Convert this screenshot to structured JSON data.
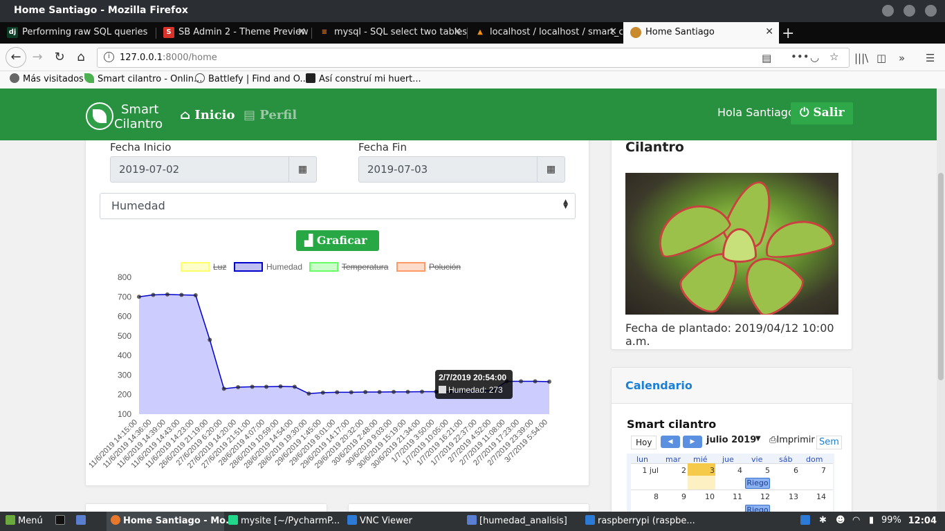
{
  "window": {
    "title": "Home Santiago - Mozilla Firefox"
  },
  "tabs": [
    {
      "label": "Performing raw SQL queries",
      "icon": "dj"
    },
    {
      "label": "SB Admin 2 - Theme Preview",
      "icon": "S"
    },
    {
      "label": "mysql - SQL select two tables",
      "icon": "stackoverflow-icon"
    },
    {
      "label": "localhost / localhost / smart_c",
      "icon": "phpmyadmin-icon"
    },
    {
      "label": "Home Santiago",
      "icon": "site-icon"
    }
  ],
  "address": {
    "host": "127.0.0.1",
    "path": ":8000/home"
  },
  "bookmarks": [
    {
      "label": "Más visitados",
      "icon": "gear-icon"
    },
    {
      "label": "Smart cilantro - Onlin...",
      "icon": "leaf-icon"
    },
    {
      "label": "Battlefy | Find and O...",
      "icon": "globe-icon"
    },
    {
      "label": "Así construí mi huert...",
      "icon": "sbo-icon"
    }
  ],
  "site": {
    "logo_line1": "Smart",
    "logo_line2": "Cilantro",
    "nav_inicio": "Inicio",
    "nav_perfil": "Perfil",
    "greeting": "Hola Santiago",
    "logout": "Salir"
  },
  "filters": {
    "start_label": "Fecha Inicio",
    "start_value": "2019-07-02",
    "end_label": "Fecha Fin",
    "end_value": "2019-07-03",
    "sensor": "Humedad",
    "plot_button": "Graficar"
  },
  "chart_data": {
    "type": "line",
    "legend": [
      "Luz",
      "Humedad",
      "Temperatura",
      "Polución"
    ],
    "legend_colors": [
      "#ffff66",
      "#0000cc",
      "#66ff66",
      "#ff9966"
    ],
    "legend_hidden": [
      true,
      false,
      true,
      true
    ],
    "ylim": [
      100,
      800
    ],
    "yticks": [
      100,
      200,
      300,
      400,
      500,
      600,
      700,
      800
    ],
    "categories": [
      "11/6/2019 14:15:00",
      "11/6/2019 14:36:00",
      "11/6/2019 14:39:00",
      "11/6/2019 14:43:00",
      "11/6/2019 14:23:00",
      "26/6/2019 21:19:00",
      "27/6/2019 6:20:00",
      "27/6/2019 14:20:00",
      "27/6/2019 21:51:00",
      "28/6/2019 4:07:00",
      "28/6/2019 10:59:00",
      "28/6/2019 14:54:00",
      "28/6/2019 19:30:00",
      "29/6/2019 1:45:00",
      "29/6/2019 8:01:00",
      "29/6/2019 14:17:00",
      "29/6/2019 20:32:00",
      "30/6/2019 2:48:00",
      "30/6/2019 9:03:00",
      "30/6/2019 15:19:00",
      "30/6/2019 21:34:00",
      "1/7/2019 3:50:00",
      "1/7/2019 10:05:00",
      "1/7/2019 16:21:00",
      "1/7/2019 22:37:00",
      "2/7/2019 4:52:00",
      "2/7/2019 11:08:00",
      "2/7/2019 17:23:00",
      "2/7/2019 23:39:00",
      "3/7/2019 5:54:00"
    ],
    "series": [
      {
        "name": "Humedad",
        "values": [
          700,
          710,
          712,
          710,
          708,
          480,
          230,
          238,
          240,
          240,
          242,
          240,
          205,
          210,
          212,
          212,
          213,
          213,
          214,
          214,
          215,
          215,
          215,
          216,
          218,
          220,
          268,
          268,
          268,
          266
        ]
      }
    ],
    "tooltip": {
      "title": "2/7/2019 20:54:00",
      "label": "Humedad: 273"
    }
  },
  "plant_card": {
    "title": "Cilantro",
    "date": "Fecha de plantado: 2019/04/12 10:00 a.m."
  },
  "calendar": {
    "header": "Calendario",
    "title": "Smart cilantro",
    "today": "Hoy",
    "month": "julio 2019",
    "print": "Imprimir",
    "view": "Sem",
    "dows": [
      "lun",
      "mar",
      "mié",
      "jue",
      "vie",
      "sáb",
      "dom"
    ],
    "week1": [
      "1 jul",
      "2",
      "3",
      "4",
      "5",
      "6",
      "7"
    ],
    "week2": [
      "8",
      "9",
      "10",
      "11",
      "12",
      "13",
      "14"
    ],
    "event": "Riego"
  },
  "taskbar": {
    "menu": "Menú",
    "items": [
      "Home Santiago - Mo...",
      "mysite [~/PycharmP...",
      "VNC Viewer",
      "[humedad_analisis]",
      "raspberrypi (raspbe..."
    ],
    "battery": "99%",
    "clock": "12:04"
  }
}
